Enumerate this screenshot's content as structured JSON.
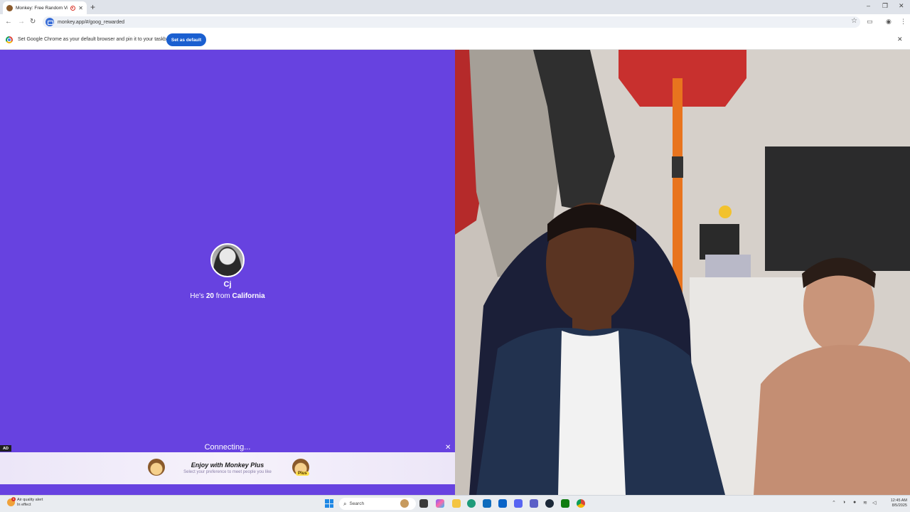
{
  "browser": {
    "tab_title": "Monkey: Free Random Vid",
    "new_tab_label": "+",
    "url": "monkey.app/#/goog_rewarded",
    "window_controls": {
      "minimize": "–",
      "restore": "❐",
      "close": "✕"
    },
    "nav": {
      "back": "←",
      "forward": "→",
      "reload": "↻"
    },
    "toolbar_icons": [
      "bookmark-star-icon",
      "cast-icon",
      "profile-icon",
      "more-menu-icon"
    ]
  },
  "infobar": {
    "message": "Set Google Chrome as your default browser and pin it to your taskbar",
    "button_label": "Set as default",
    "close": "✕"
  },
  "match": {
    "name": "Cj",
    "info_prefix": "He's",
    "age": "20",
    "from_word": "from",
    "location": "California",
    "status": "Connecting..."
  },
  "ad": {
    "label": "AD",
    "close": "✕",
    "title": "Enjoy with Monkey Plus",
    "subtitle": "Select your preference to meet people you like",
    "badge": "Plus"
  },
  "colors": {
    "panel_bg": "#6742e0",
    "accent_button": "#1a5fd0"
  },
  "taskbar": {
    "weather_line1": "Air quality alert",
    "weather_line2": "In effect",
    "weather_badge": "1",
    "search_placeholder": "Search",
    "time": "12:45 AM",
    "date": "8/5/2025",
    "pinned_apps": [
      "file-explorer-icon",
      "copilot-icon",
      "folder-icon",
      "store-icon",
      "edge-icon",
      "outlook-icon",
      "discord-icon",
      "teams-icon",
      "steam-icon",
      "xbox-icon",
      "chrome-icon"
    ]
  }
}
